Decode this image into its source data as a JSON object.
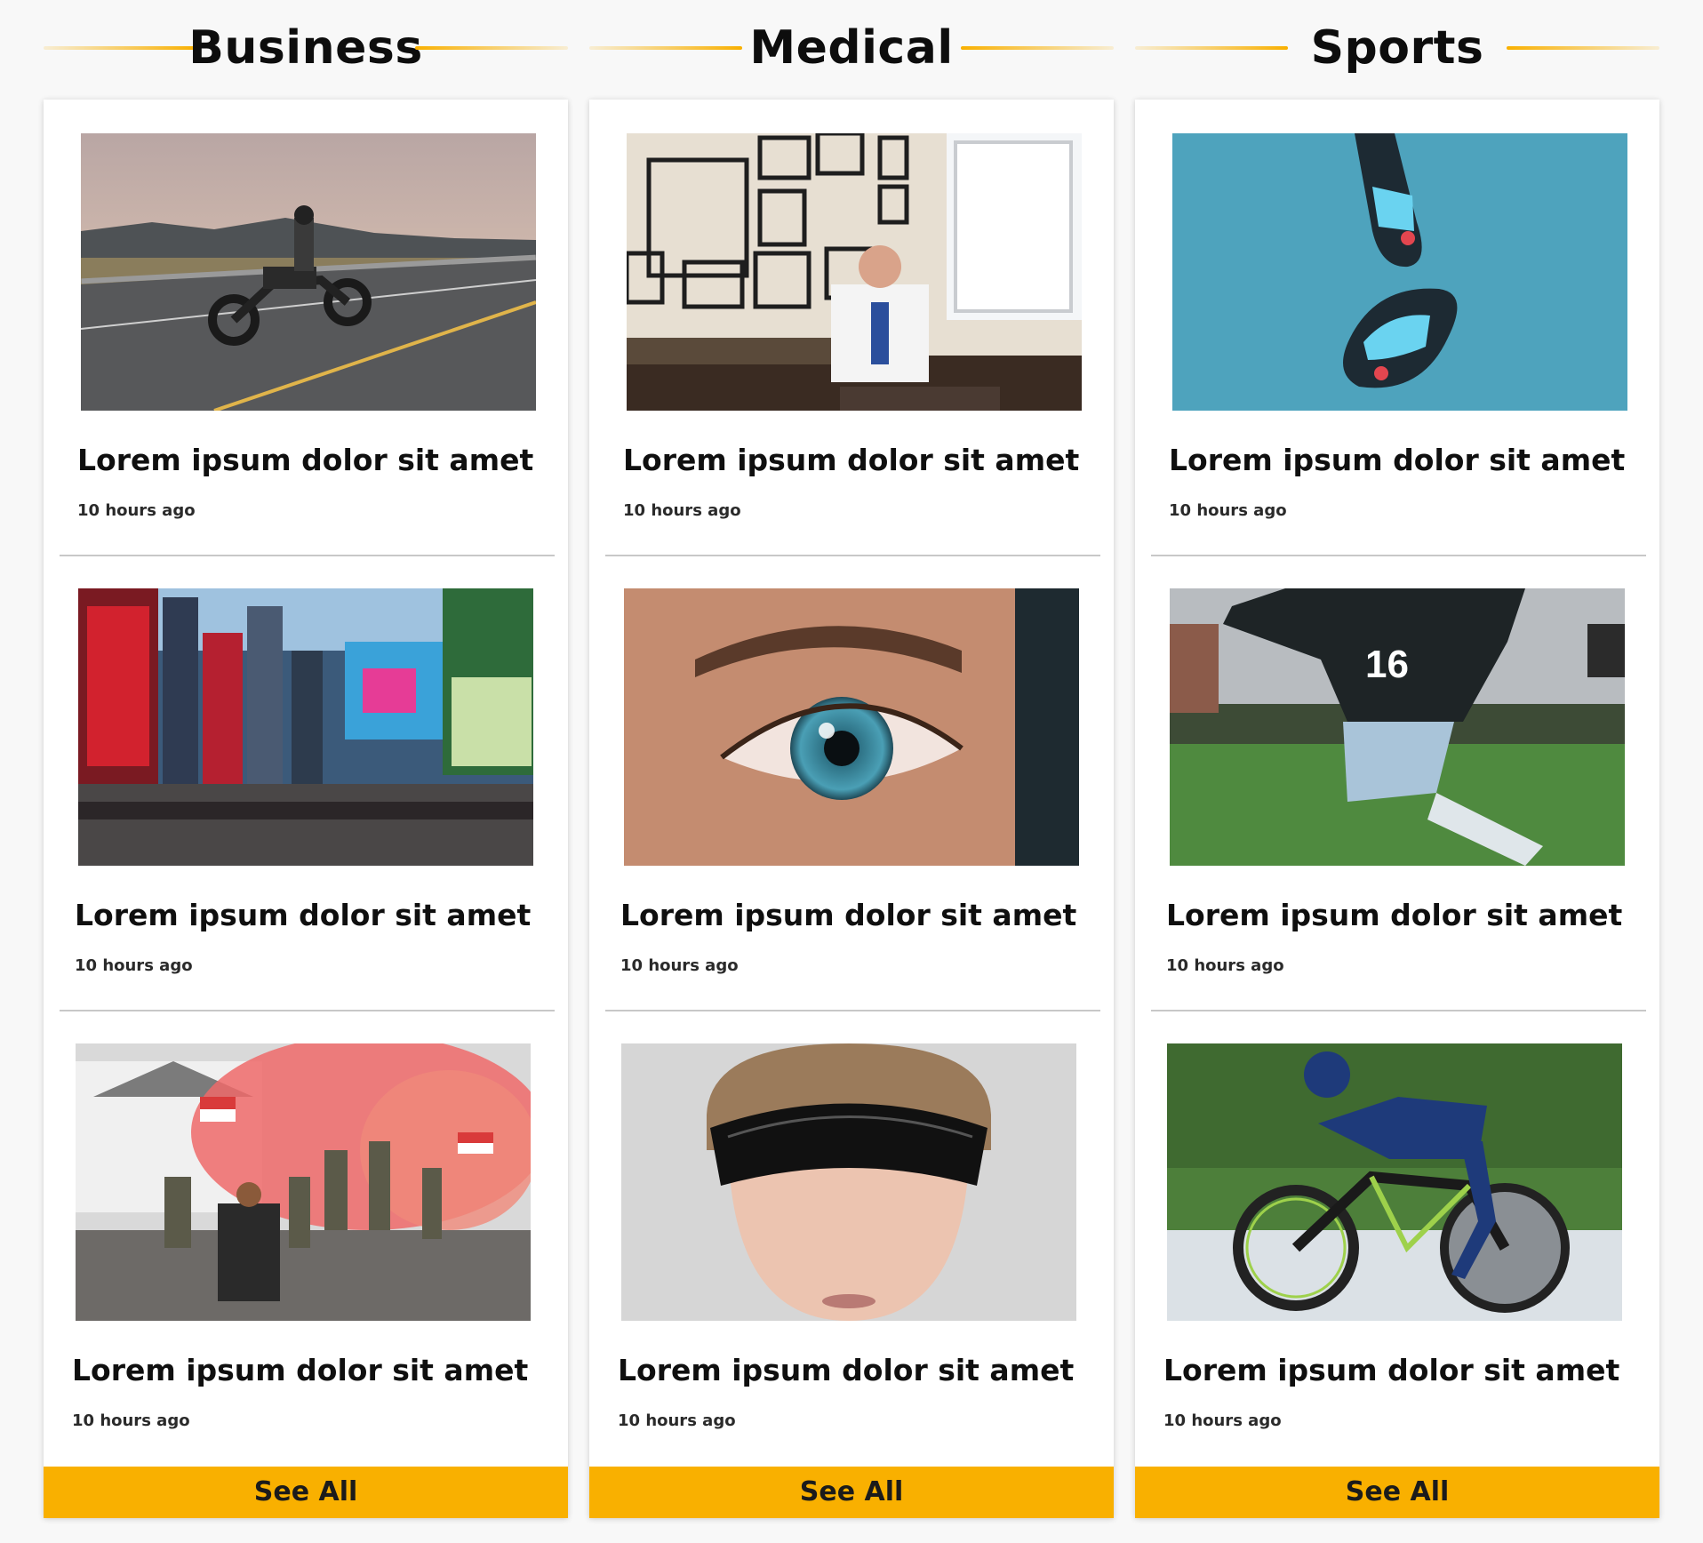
{
  "columns": [
    {
      "title": "Business",
      "see_all_label": "See All",
      "items": [
        {
          "title": "Lorem ipsum dolor sit amet",
          "time": "10 hours ago",
          "image": "motorcycle-road"
        },
        {
          "title": "Lorem ipsum dolor sit amet",
          "time": "10 hours ago",
          "image": "city-billboards"
        },
        {
          "title": "Lorem ipsum dolor sit amet",
          "time": "10 hours ago",
          "image": "soldiers-smoke"
        }
      ]
    },
    {
      "title": "Medical",
      "see_all_label": "See All",
      "items": [
        {
          "title": "Lorem ipsum dolor sit amet",
          "time": "10 hours ago",
          "image": "doctor-office"
        },
        {
          "title": "Lorem ipsum dolor sit amet",
          "time": "10 hours ago",
          "image": "eye-closeup"
        },
        {
          "title": "Lorem ipsum dolor sit amet",
          "time": "10 hours ago",
          "image": "woman-visor"
        }
      ]
    },
    {
      "title": "Sports",
      "see_all_label": "See All",
      "items": [
        {
          "title": "Lorem ipsum dolor sit amet",
          "time": "10 hours ago",
          "image": "football-boots"
        },
        {
          "title": "Lorem ipsum dolor sit amet",
          "time": "10 hours ago",
          "image": "soccer-player"
        },
        {
          "title": "Lorem ipsum dolor sit amet",
          "time": "10 hours ago",
          "image": "cyclist"
        }
      ]
    }
  ],
  "colors": {
    "accent": "#f9b000",
    "background": "#f8f8f8",
    "card": "#ffffff"
  }
}
